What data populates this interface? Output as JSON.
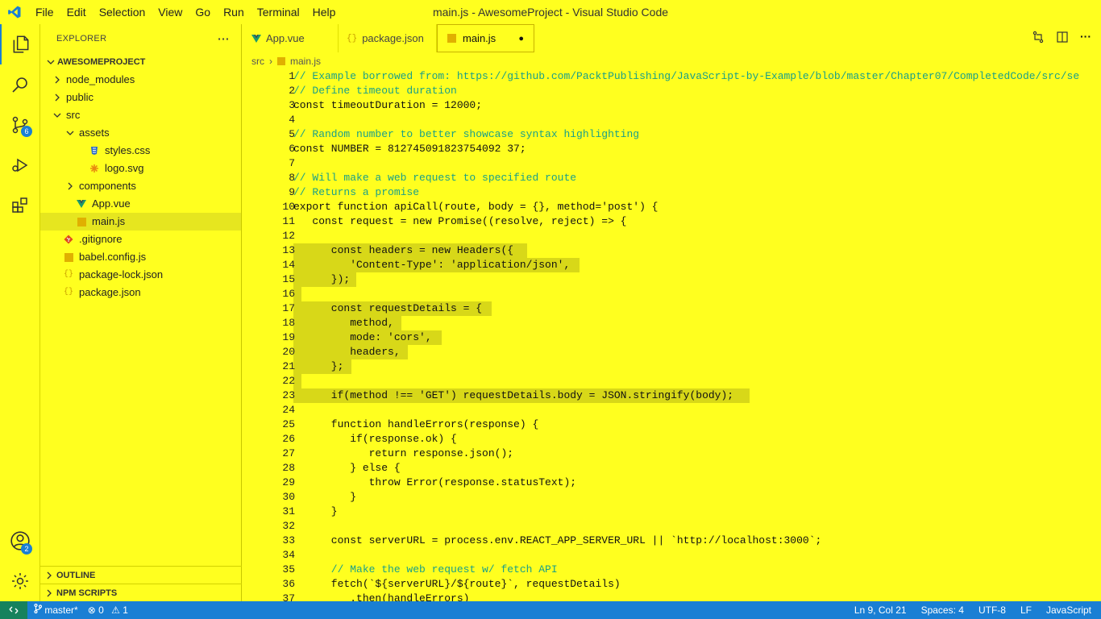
{
  "window": {
    "title": "main.js - AwesomeProject - Visual Studio Code"
  },
  "menu": [
    "File",
    "Edit",
    "Selection",
    "View",
    "Go",
    "Run",
    "Terminal",
    "Help"
  ],
  "activity": {
    "scm_badge": "6",
    "accounts_badge": "2"
  },
  "explorer": {
    "header": "EXPLORER",
    "more": "···",
    "project": "AWESOMEPROJECT",
    "tree": [
      {
        "label": "node_modules",
        "depth": 1,
        "type": "folder",
        "open": false
      },
      {
        "label": "public",
        "depth": 1,
        "type": "folder",
        "open": false
      },
      {
        "label": "src",
        "depth": 1,
        "type": "folder",
        "open": true
      },
      {
        "label": "assets",
        "depth": 2,
        "type": "folder",
        "open": true
      },
      {
        "label": "styles.css",
        "depth": 3,
        "type": "css"
      },
      {
        "label": "logo.svg",
        "depth": 3,
        "type": "svg"
      },
      {
        "label": "components",
        "depth": 2,
        "type": "folder",
        "open": false
      },
      {
        "label": "App.vue",
        "depth": 2,
        "type": "vue"
      },
      {
        "label": "main.js",
        "depth": 2,
        "type": "js",
        "selected": true
      },
      {
        "label": ".gitignore",
        "depth": 1,
        "type": "git"
      },
      {
        "label": "babel.config.js",
        "depth": 1,
        "type": "js"
      },
      {
        "label": "package-lock.json",
        "depth": 1,
        "type": "json"
      },
      {
        "label": "package.json",
        "depth": 1,
        "type": "json"
      }
    ],
    "outline": "OUTLINE",
    "npm_scripts": "NPM SCRIPTS"
  },
  "tabs": [
    {
      "label": "App.vue",
      "type": "vue"
    },
    {
      "label": "package.json",
      "type": "json"
    },
    {
      "label": "main.js",
      "type": "js",
      "active": true,
      "dirty": "●"
    }
  ],
  "breadcrumb": {
    "folder": "src",
    "file": "main.js",
    "sep": "›"
  },
  "code": [
    "// Example borrowed from: https://github.com/PacktPublishing/JavaScript-by-Example/blob/master/Chapter07/CompletedCode/src/se",
    "// Define timeout duration",
    "const timeoutDuration = 12000;",
    "",
    "// Random number to better showcase syntax highlighting",
    "const NUMBER = 812745091823754092 37;",
    "",
    "// Will make a web request to specified route",
    "// Returns a promise",
    "export function apiCall(route, body = {}, method='post') {",
    "   const request = new Promise((resolve, reject) => {",
    "",
    "      const headers = new Headers({",
    "         'Content-Type': 'application/json',",
    "      });",
    "",
    "      const requestDetails = {",
    "         method,",
    "         mode: 'cors',",
    "         headers,",
    "      };",
    "",
    "      if(method !== 'GET') requestDetails.body = JSON.stringify(body);",
    "",
    "      function handleErrors(response) {",
    "         if(response.ok) {",
    "            return response.json();",
    "         } else {",
    "            throw Error(response.statusText);",
    "         }",
    "      }",
    "",
    "      const serverURL = process.env.REACT_APP_SERVER_URL || `http://localhost:3000`;",
    "",
    "      // Make the web request w/ fetch API",
    "      fetch(`${serverURL}/${route}`, requestDetails)",
    "         .then(handleErrors)"
  ],
  "status": {
    "branch": "master*",
    "errors": "0",
    "warnings": "1",
    "position": "Ln 9, Col 21",
    "spaces": "Spaces: 4",
    "encoding": "UTF-8",
    "eol": "LF",
    "language": "JavaScript"
  }
}
